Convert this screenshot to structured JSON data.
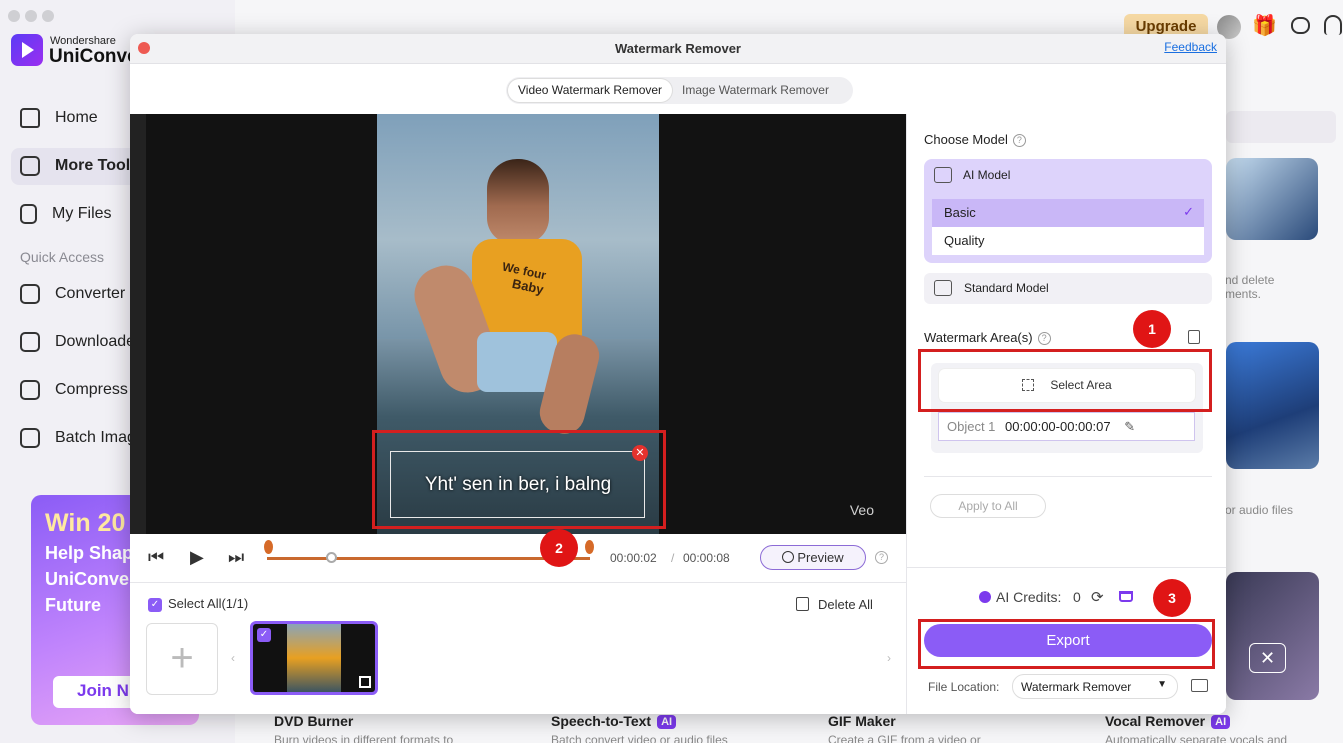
{
  "app": {
    "brand_small": "Wondershare",
    "brand_large": "UniConve",
    "upgrade_label": "Upgrade"
  },
  "sidebar": {
    "items": [
      {
        "label": "Home"
      },
      {
        "label": "More Tool"
      },
      {
        "label": "My Files"
      }
    ],
    "quick_access_label": "Quick Access",
    "quick_items": [
      {
        "label": "Converter"
      },
      {
        "label": "Downloade"
      },
      {
        "label": "Compress"
      },
      {
        "label": "Batch Imag"
      }
    ],
    "promo": {
      "line1": "Win 20",
      "line2": "Help Shap",
      "line3": "UniConve",
      "line4": "Future",
      "button": "Join N"
    }
  },
  "background_cards": {
    "partial_text_1": "nd delete",
    "partial_text_2": "ments.",
    "partial_text_3": "or audio files",
    "cards": [
      {
        "title": "DVD Burner",
        "desc": "Burn videos in different formats to",
        "ai": false
      },
      {
        "title": "Speech-to-Text",
        "desc": "Batch convert video or audio files",
        "ai": true
      },
      {
        "title": "GIF Maker",
        "desc": "Create a GIF from a video or",
        "ai": false
      },
      {
        "title": "Vocal Remover",
        "desc": "Automatically separate vocals and",
        "ai": true
      }
    ],
    "ai_tag": "AI"
  },
  "dialog": {
    "title": "Watermark Remover",
    "feedback": "Feedback",
    "tabs": [
      {
        "label": "Video Watermark Remover",
        "active": true
      },
      {
        "label": "Image Watermark Remover",
        "active": false
      }
    ],
    "video": {
      "shirt_text_1": "We four",
      "shirt_text_2": "Baby",
      "watermark_text": "Yht' sen in ber, i balng",
      "brand_mark": "Veo"
    },
    "player": {
      "current_time": "00:00:02",
      "separator": "/",
      "total_time": "00:00:08",
      "progress": 0.2,
      "preview_label": "Preview"
    },
    "files": {
      "select_all": "Select All(1/1)",
      "delete_all": "Delete All"
    },
    "panel": {
      "choose_model": "Choose Model",
      "ai_model": "AI Model",
      "options": [
        {
          "label": "Basic",
          "selected": true
        },
        {
          "label": "Quality",
          "selected": false
        }
      ],
      "standard_model": "Standard Model",
      "watermark_areas": "Watermark Area(s)",
      "select_area": "Select Area",
      "object_label": "Object 1",
      "object_range": "00:00:00-00:00:07",
      "apply_all": "Apply to All",
      "credits_label": "AI Credits:",
      "credits_value": "0",
      "export_label": "Export",
      "file_location_label": "File Location:",
      "file_location_value": "Watermark Remover"
    },
    "annotations": [
      "1",
      "2",
      "3"
    ]
  },
  "colors": {
    "accent": "#8b5cf6",
    "highlight_red": "#d41f1f",
    "badge_red": "#e01515"
  }
}
